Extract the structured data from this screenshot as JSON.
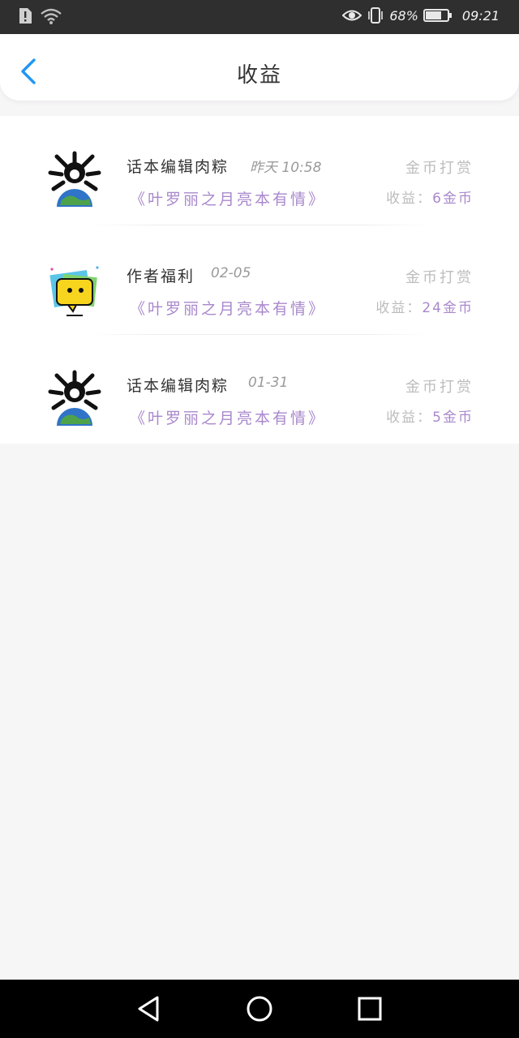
{
  "status_bar": {
    "battery": "68%",
    "time": "09:21",
    "icons": [
      "alert-icon",
      "wifi-icon",
      "eye-icon",
      "vibrate-icon",
      "battery-icon"
    ]
  },
  "header": {
    "title": "收益",
    "back_icon": "chevron-left-icon",
    "accent_color": "#2196f3"
  },
  "records": [
    {
      "sender": "话本编辑肉粽",
      "time": "昨天 10:58",
      "book": "《叶罗丽之月亮本有情》",
      "type": "金币打赏",
      "income_label": "收益：",
      "income_amount": "6金币",
      "avatar": "skull-globe-avatar"
    },
    {
      "sender": "作者福利",
      "time": "02-05",
      "book": "《叶罗丽之月亮本有情》",
      "type": "金币打赏",
      "income_label": "收益：",
      "income_amount": "24金币",
      "avatar": "chat-bubble-avatar"
    },
    {
      "sender": "话本编辑肉粽",
      "time": "01-31",
      "book": "《叶罗丽之月亮本有情》",
      "type": "金币打赏",
      "income_label": "收益：",
      "income_amount": "5金币",
      "avatar": "skull-globe-avatar"
    }
  ],
  "nav_bar": {
    "buttons": [
      "back-triangle-icon",
      "home-circle-icon",
      "recents-square-icon"
    ]
  },
  "colors": {
    "book_title": "#a988cc",
    "status_bar_bg": "#2f2f2f",
    "page_bg": "#f7f6f7"
  }
}
